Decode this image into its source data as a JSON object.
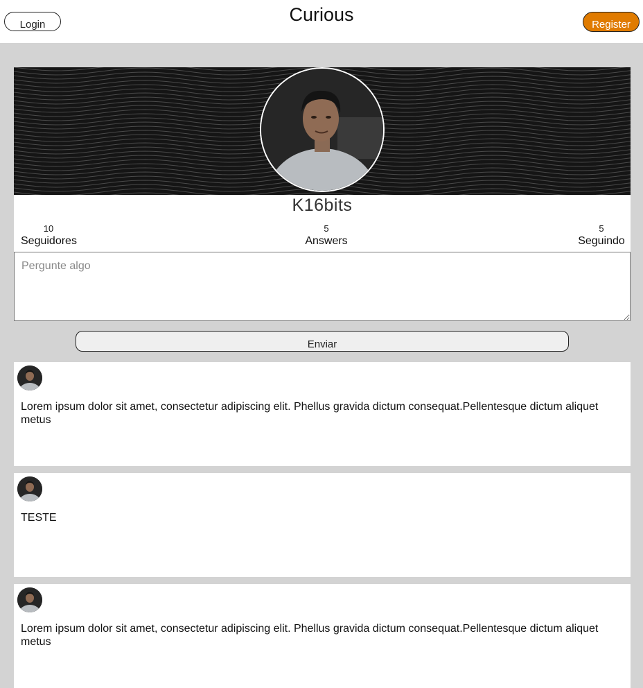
{
  "header": {
    "title": "Curious",
    "login_label": "Login",
    "register_label": "Register"
  },
  "profile": {
    "username": "K16bits",
    "stats": {
      "followers": {
        "count": "10",
        "label": "Seguidores"
      },
      "answers": {
        "count": "5",
        "label": "Answers"
      },
      "following": {
        "count": "5",
        "label": "Seguindo"
      }
    }
  },
  "ask": {
    "placeholder": "Pergunte algo",
    "send_label": "Enviar"
  },
  "posts": [
    {
      "text": "Lorem ipsum dolor sit amet, consectetur adipiscing elit. Phellus gravida dictum consequat.Pellentesque dictum aliquet metus"
    },
    {
      "text": "TESTE"
    },
    {
      "text": "Lorem ipsum dolor sit amet, consectetur adipiscing elit. Phellus gravida dictum consequat.Pellentesque dictum aliquet metus"
    }
  ],
  "colors": {
    "accent": "#e07b00",
    "background": "#d3d3d3",
    "banner": "#151515"
  }
}
